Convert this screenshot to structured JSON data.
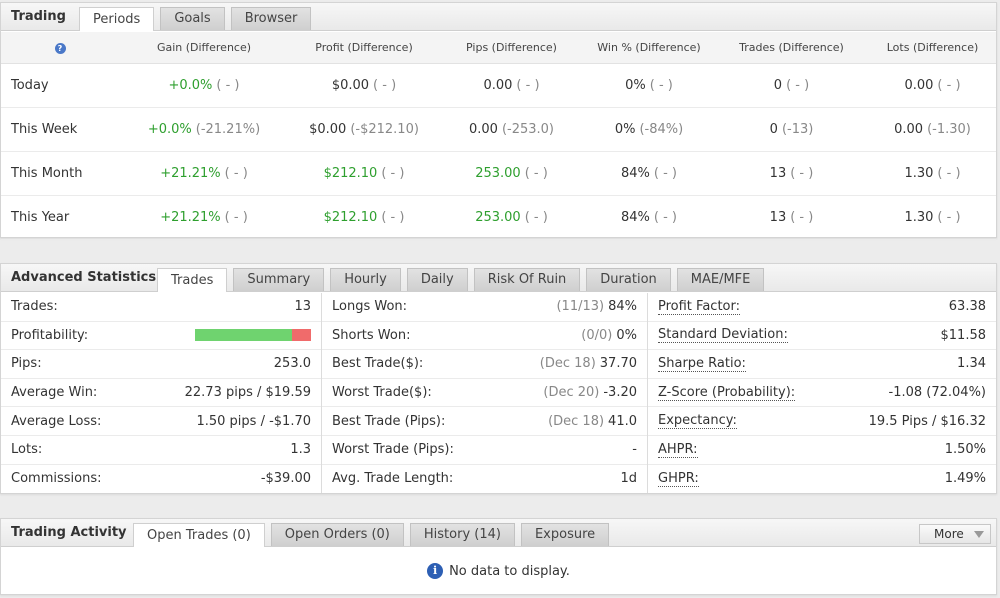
{
  "trading": {
    "title": "Trading",
    "tabs": [
      "Periods",
      "Goals",
      "Browser"
    ],
    "help_glyph": "?",
    "headers": [
      "Gain (Difference)",
      "Profit (Difference)",
      "Pips (Difference)",
      "Win % (Difference)",
      "Trades (Difference)",
      "Lots (Difference)"
    ],
    "rows": [
      {
        "period": "Today",
        "cells": [
          {
            "v": "+0.0%",
            "d": "( - )",
            "pos": true
          },
          {
            "v": "$0.00",
            "d": "( - )",
            "pos": false
          },
          {
            "v": "0.00",
            "d": "( - )",
            "pos": false
          },
          {
            "v": "0%",
            "d": "( - )",
            "pos": false
          },
          {
            "v": "0",
            "d": "( - )",
            "pos": false
          },
          {
            "v": "0.00",
            "d": "( - )",
            "pos": false
          }
        ]
      },
      {
        "period": "This Week",
        "cells": [
          {
            "v": "+0.0%",
            "d": "(-21.21%)",
            "pos": true
          },
          {
            "v": "$0.00",
            "d": "(-$212.10)",
            "pos": false
          },
          {
            "v": "0.00",
            "d": "(-253.0)",
            "pos": false
          },
          {
            "v": "0%",
            "d": "(-84%)",
            "pos": false
          },
          {
            "v": "0",
            "d": "(-13)",
            "pos": false
          },
          {
            "v": "0.00",
            "d": "(-1.30)",
            "pos": false
          }
        ]
      },
      {
        "period": "This Month",
        "cells": [
          {
            "v": "+21.21%",
            "d": "( - )",
            "pos": true
          },
          {
            "v": "$212.10",
            "d": "( - )",
            "pos": true
          },
          {
            "v": "253.00",
            "d": "( - )",
            "pos": true
          },
          {
            "v": "84%",
            "d": "( - )",
            "pos": false
          },
          {
            "v": "13",
            "d": "( - )",
            "pos": false
          },
          {
            "v": "1.30",
            "d": "( - )",
            "pos": false
          }
        ]
      },
      {
        "period": "This Year",
        "cells": [
          {
            "v": "+21.21%",
            "d": "( - )",
            "pos": true
          },
          {
            "v": "$212.10",
            "d": "( - )",
            "pos": true
          },
          {
            "v": "253.00",
            "d": "( - )",
            "pos": true
          },
          {
            "v": "84%",
            "d": "( - )",
            "pos": false
          },
          {
            "v": "13",
            "d": "( - )",
            "pos": false
          },
          {
            "v": "1.30",
            "d": "( - )",
            "pos": false
          }
        ]
      }
    ]
  },
  "advanced": {
    "title": "Advanced Statistics",
    "tabs": [
      "Trades",
      "Summary",
      "Hourly",
      "Daily",
      "Risk Of Ruin",
      "Duration",
      "MAE/MFE"
    ],
    "profitability_win_fraction": 0.84,
    "col1": [
      {
        "label": "Trades:",
        "value": "13"
      },
      {
        "label": "Profitability:",
        "value": ""
      },
      {
        "label": "Pips:",
        "value": "253.0"
      },
      {
        "label": "Average Win:",
        "value": "22.73 pips / $19.59"
      },
      {
        "label": "Average Loss:",
        "value": "1.50 pips / -$1.70"
      },
      {
        "label": "Lots:",
        "value": "1.3"
      },
      {
        "label": "Commissions:",
        "value": "-$39.00"
      }
    ],
    "col2": [
      {
        "label": "Longs Won:",
        "note": "(11/13)",
        "value": "84%"
      },
      {
        "label": "Shorts Won:",
        "note": "(0/0)",
        "value": "0%"
      },
      {
        "label": "Best Trade($):",
        "note": "(Dec 18)",
        "value": "37.70"
      },
      {
        "label": "Worst Trade($):",
        "note": "(Dec 20)",
        "value": "-3.20"
      },
      {
        "label": "Best Trade (Pips):",
        "note": "(Dec 18)",
        "value": "41.0"
      },
      {
        "label": "Worst Trade (Pips):",
        "note": "",
        "value": "-"
      },
      {
        "label": "Avg. Trade Length:",
        "note": "",
        "value": "1d"
      }
    ],
    "col3": [
      {
        "label": "Profit Factor:",
        "value": "63.38"
      },
      {
        "label": "Standard Deviation:",
        "value": "$11.58"
      },
      {
        "label": "Sharpe Ratio:",
        "value": "1.34"
      },
      {
        "label": "Z-Score (Probability):",
        "value": "-1.08 (72.04%)"
      },
      {
        "label": "Expectancy:",
        "value": "19.5 Pips / $16.32"
      },
      {
        "label": "AHPR:",
        "value": "1.50%"
      },
      {
        "label": "GHPR:",
        "value": "1.49%"
      }
    ]
  },
  "activity": {
    "title": "Trading Activity",
    "tabs": [
      "Open Trades (0)",
      "Open Orders (0)",
      "History (14)",
      "Exposure"
    ],
    "more_label": "More",
    "info_glyph": "i",
    "no_data": "No data to display."
  }
}
